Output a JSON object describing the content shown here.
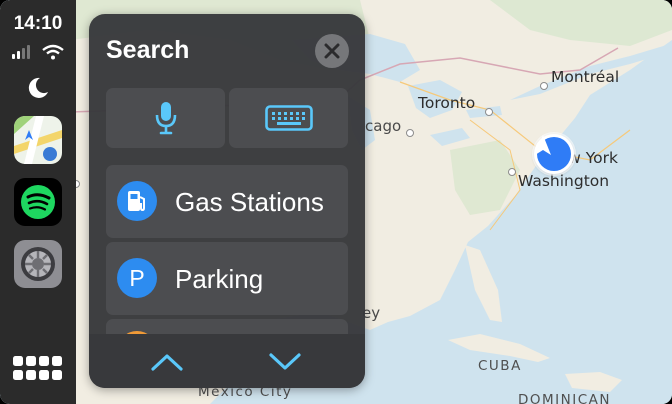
{
  "status_bar": {
    "time": "14:10"
  },
  "sidebar": {
    "apps": [
      {
        "name": "Maps",
        "icon": "maps-app-icon"
      },
      {
        "name": "Spotify",
        "icon": "spotify-app-icon"
      },
      {
        "name": "Settings",
        "icon": "settings-app-icon"
      }
    ]
  },
  "search_panel": {
    "title": "Search",
    "voice_button": "microphone-icon",
    "keyboard_button": "keyboard-icon",
    "categories": [
      {
        "label": "Gas Stations",
        "icon": "gas-station-icon"
      },
      {
        "label": "Parking",
        "icon_text": "P"
      }
    ]
  },
  "map": {
    "labels": {
      "montreal": "Montréal",
      "toronto": "Toronto",
      "chicago": "cago",
      "new_york": "New York",
      "washington": "Washington",
      "cuba": "CUBA",
      "mexico_city": "Mexico City",
      "dominican": "DOMINICAN",
      "ey": "ey"
    }
  },
  "colors": {
    "accent_blue": "#2d8cf0",
    "nav_blue": "#2f7cf6",
    "water": "#cfe3ee",
    "land": "#f1ede2",
    "panel": "#38393c"
  }
}
